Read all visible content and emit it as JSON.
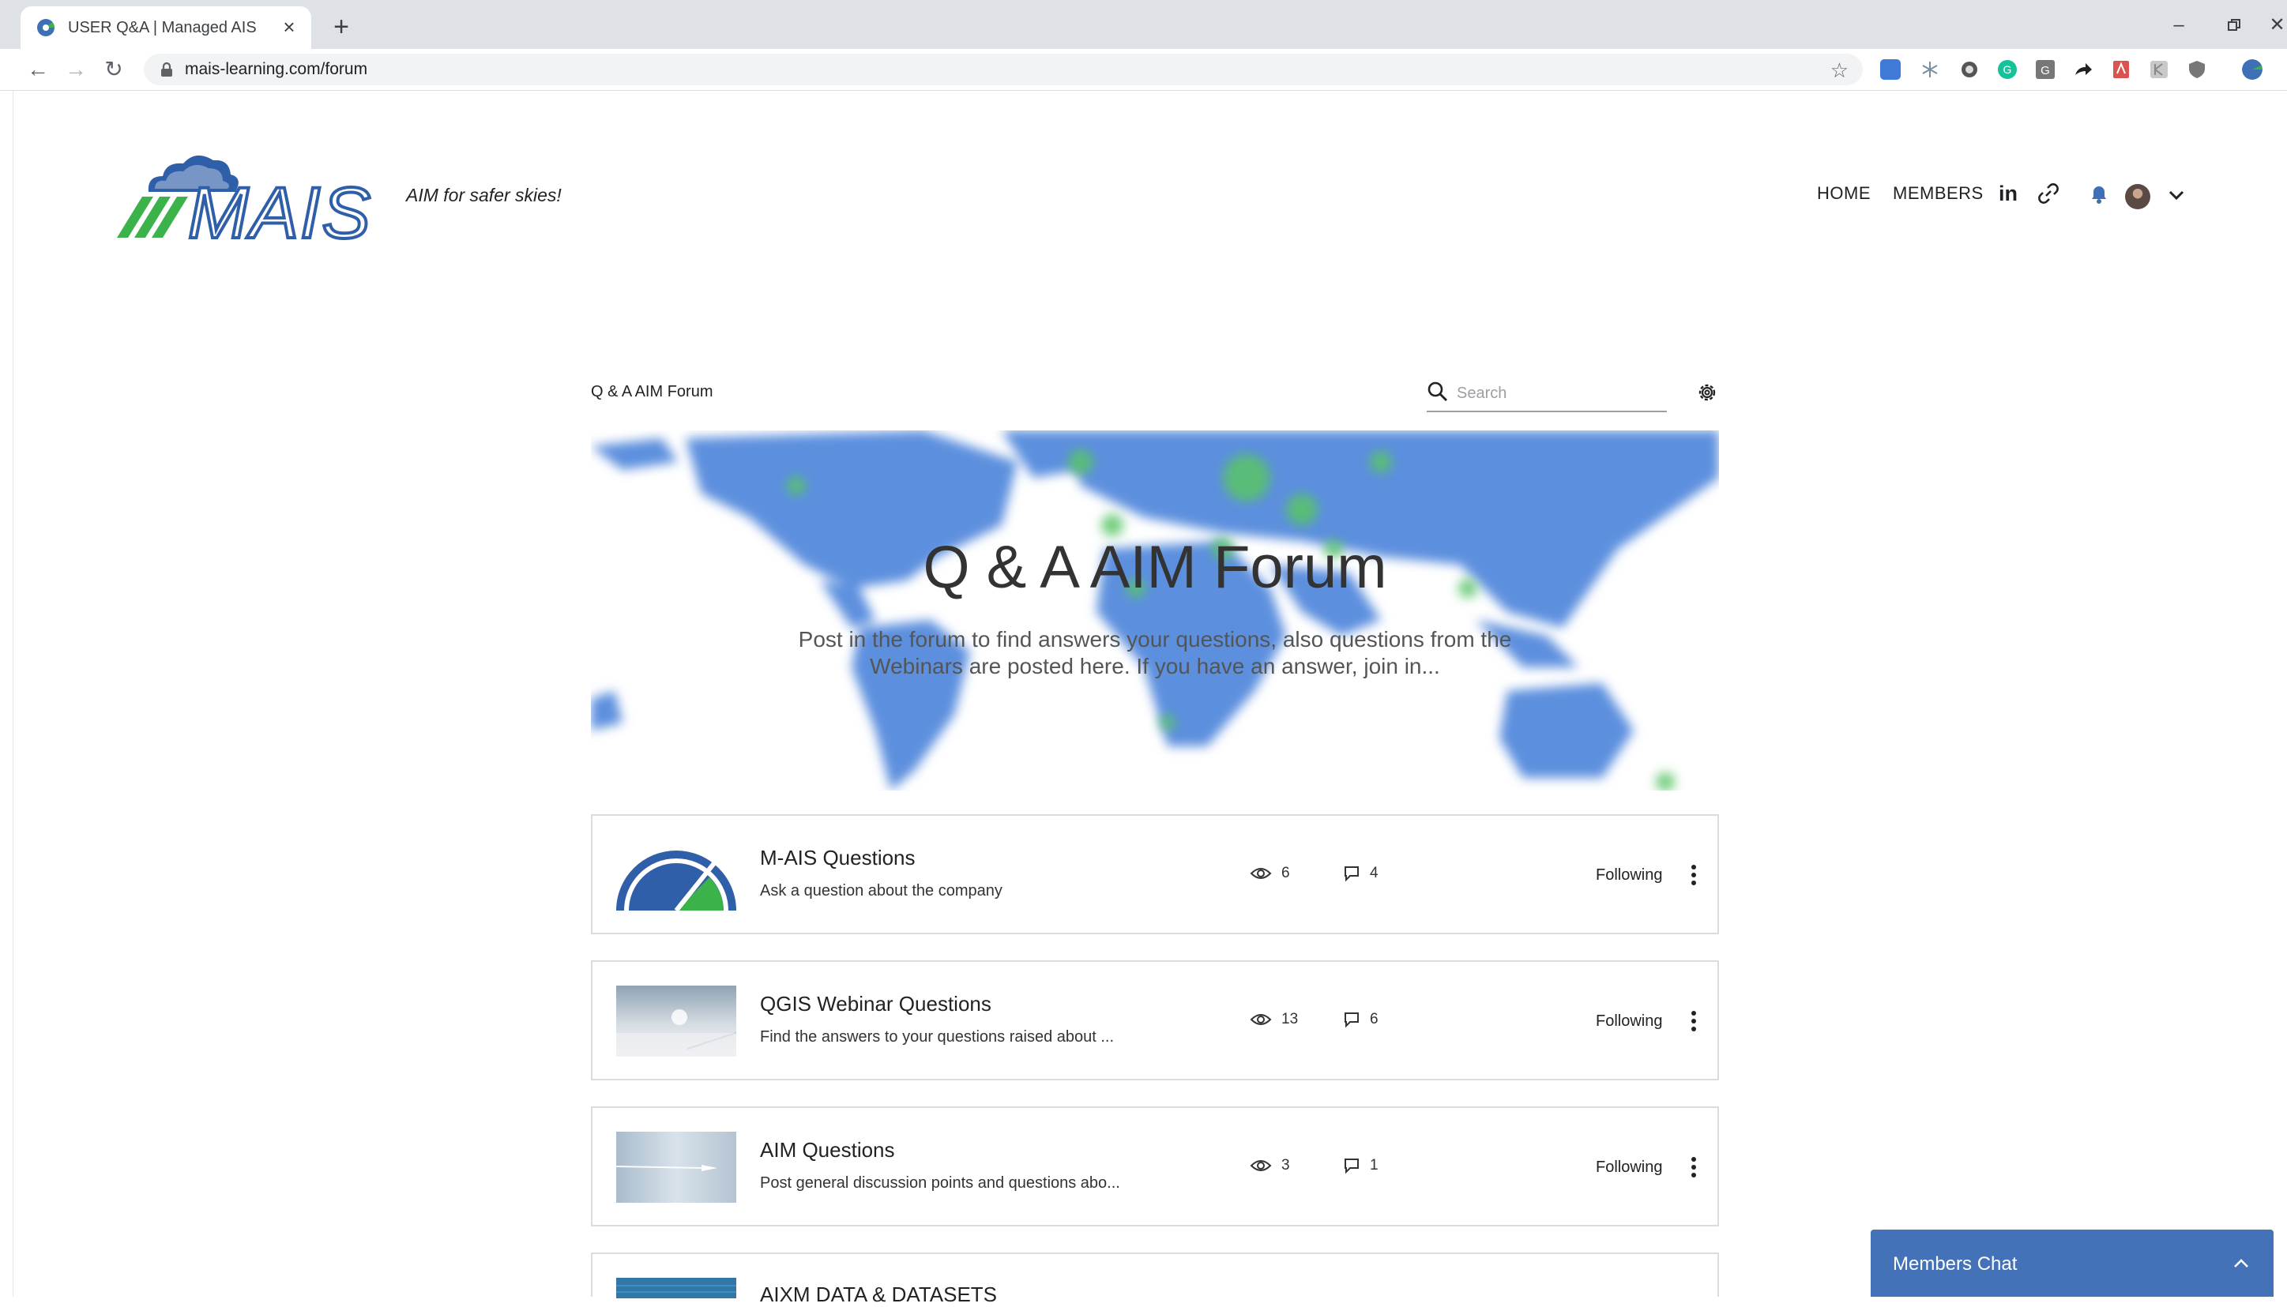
{
  "browser": {
    "tab_title": "USER Q&A | Managed AIS",
    "tab_close": "×",
    "new_tab": "+",
    "url": "mais-learning.com/forum"
  },
  "site": {
    "logo_text": "MAIS",
    "tagline": "AIM for safer skies!",
    "nav": {
      "home": "HOME",
      "members": "MEMBERS"
    },
    "linkedin": "in"
  },
  "forum": {
    "breadcrumb": "Q & A AIM Forum",
    "search_placeholder": "Search",
    "hero_title": "Q & A AIM Forum",
    "hero_subtitle": "Post in the forum to find answers your questions, also questions from the Webinars are posted here. If you have an answer, join in...",
    "categories": [
      {
        "title": "M-AIS Questions",
        "description": "Ask a question about the company",
        "views": "6",
        "posts": "4",
        "follow": "Following"
      },
      {
        "title": "QGIS Webinar Questions",
        "description": "Find the answers to your questions raised about ...",
        "views": "13",
        "posts": "6",
        "follow": "Following"
      },
      {
        "title": "AIM Questions",
        "description": "Post general discussion points and questions abo...",
        "views": "3",
        "posts": "1",
        "follow": "Following"
      },
      {
        "title": "AIXM DATA & DATASETS",
        "description": "",
        "views": "",
        "posts": "",
        "follow": ""
      }
    ]
  },
  "chat": {
    "title": "Members Chat"
  }
}
